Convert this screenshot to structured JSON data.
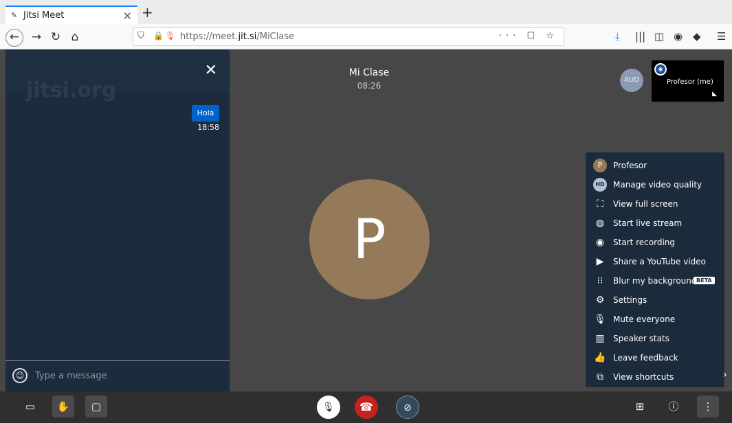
{
  "browser": {
    "tab_title": "Jitsi Meet",
    "tab_close": "×",
    "new_tab": "+",
    "url_prefix": "https://meet.",
    "url_host": "jit.si",
    "url_path": "/MiClase",
    "url_actions": "··· ☐ ☆"
  },
  "chat": {
    "watermark": "jitsi.org",
    "close": "✕",
    "messages": [
      {
        "text": "Hola",
        "time": "18:58"
      }
    ],
    "input_placeholder": "Type a message"
  },
  "conference": {
    "title": "Mi Clase",
    "elapsed": "08:26",
    "speaker_initial": "P"
  },
  "filmstrip": {
    "remote_label": "AUD",
    "self_name": "Profesor (me)"
  },
  "menu": {
    "items": [
      {
        "icon": "profile-avatar-icon",
        "glyph": "P",
        "label": "Profesor"
      },
      {
        "icon": "hd-icon",
        "glyph": "HD",
        "label": "Manage video quality"
      },
      {
        "icon": "fullscreen-icon",
        "glyph": "⛶",
        "label": "View full screen"
      },
      {
        "icon": "globe-icon",
        "glyph": "◍",
        "label": "Start live stream"
      },
      {
        "icon": "record-icon",
        "glyph": "◉",
        "label": "Start recording"
      },
      {
        "icon": "play-circle-icon",
        "glyph": "▶",
        "label": "Share a YouTube video"
      },
      {
        "icon": "blur-icon",
        "glyph": "⁝⁝",
        "label": "Blur my background"
      },
      {
        "icon": "gear-icon",
        "glyph": "⚙",
        "label": "Settings"
      },
      {
        "icon": "mute-everyone-icon",
        "glyph": "🎙",
        "label": "Mute everyone"
      },
      {
        "icon": "stats-icon",
        "glyph": "▥",
        "label": "Speaker stats"
      },
      {
        "icon": "thumbs-up-icon",
        "glyph": "👍",
        "label": "Leave feedback"
      },
      {
        "icon": "external-link-icon",
        "glyph": "⧉",
        "label": "View shortcuts"
      }
    ],
    "beta_badge": "BETA"
  },
  "colors": {
    "stage": "#474747",
    "chat_bg": "#1d2c3c",
    "menu_bg": "#1c2b3b",
    "avatar": "#957a59",
    "hangup": "#c3231c",
    "message_bubble": "#0063cc"
  }
}
